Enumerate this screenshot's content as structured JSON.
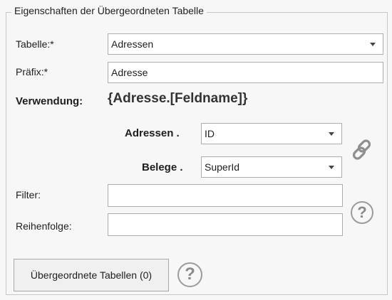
{
  "group": {
    "title": "Eigenschaften der Übergeordneten Tabelle"
  },
  "table": {
    "label": "Tabelle:*",
    "value": "Adressen"
  },
  "prefix": {
    "label": "Präfix:*",
    "value": "Adresse"
  },
  "usage": {
    "label": "Verwendung:",
    "value": "{Adresse.[Feldname]}"
  },
  "mapping": {
    "parent": {
      "label": "Adressen .",
      "value": "ID"
    },
    "child": {
      "label": "Belege .",
      "value": "SuperId"
    },
    "link_icon": "chain-link-icon"
  },
  "filter": {
    "label": "Filter:",
    "value": "",
    "help_icon": "help-icon"
  },
  "order": {
    "label": "Reihenfolge:",
    "value": ""
  },
  "parent_tables_button": {
    "label": "Übergeordnete Tabellen (0)",
    "help_icon": "help-icon"
  }
}
